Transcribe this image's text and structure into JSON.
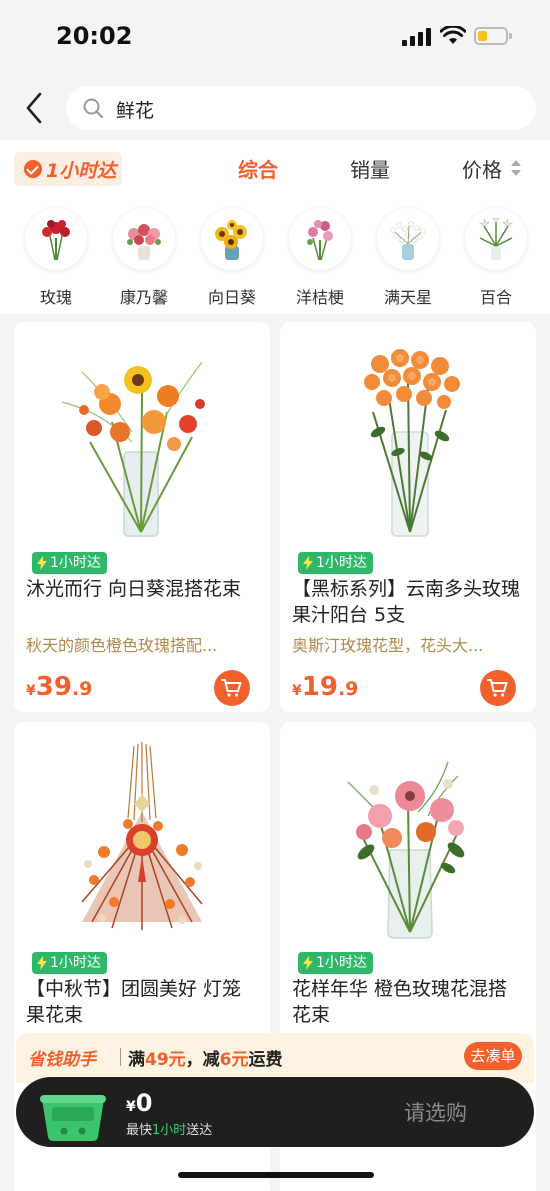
{
  "status": {
    "time": "20:02",
    "battery_level": 0.35
  },
  "search": {
    "query": "鲜花"
  },
  "filters": {
    "badge": "1小时达",
    "tabs": [
      {
        "label": "综合"
      },
      {
        "label": "销量"
      },
      {
        "label": "价格"
      }
    ],
    "active_tab": "综合"
  },
  "categories": [
    {
      "label": "玫瑰",
      "icon": "rose-bouquet-icon"
    },
    {
      "label": "康乃馨",
      "icon": "carnation-bouquet-icon"
    },
    {
      "label": "向日葵",
      "icon": "sunflower-bouquet-icon"
    },
    {
      "label": "洋桔梗",
      "icon": "lisianthus-bouquet-icon"
    },
    {
      "label": "满天星",
      "icon": "babys-breath-icon"
    },
    {
      "label": "百合",
      "icon": "lily-bouquet-icon"
    }
  ],
  "products": [
    {
      "tag": "1小时达",
      "title": "沐光而行 向日葵混搭花束",
      "subtitle": "秋天的颜色橙色玫瑰搭配...",
      "price_yen": "¥",
      "price_int": "39",
      "price_dec": ".9"
    },
    {
      "tag": "1小时达",
      "title": "【黑标系列】云南多头玫瑰 果汁阳台 5支",
      "subtitle": "奥斯汀玫瑰花型，花头大...",
      "price_yen": "¥",
      "price_int": "19",
      "price_dec": ".9"
    },
    {
      "tag": "1小时达",
      "title": "【中秋节】团圆美好 灯笼果花束"
    },
    {
      "tag": "1小时达",
      "title": "花样年华 橙色玫瑰花混搭花束"
    }
  ],
  "helper": {
    "name": "省钱助手",
    "t1": "满",
    "amount1": "49元",
    "t2": "，减",
    "amount2": "6元",
    "t3": "运费",
    "button": "去凑单"
  },
  "cart": {
    "yen": "¥",
    "total": "0",
    "delivery_prefix": "最快",
    "delivery_highlight": "1小时",
    "delivery_suffix": "送达",
    "checkout": "请选购"
  },
  "colors": {
    "accent": "#f1602d",
    "green": "#2fb86a",
    "helper_bg": "#fdf3e2",
    "cart_bar": "#1f1f1f"
  }
}
